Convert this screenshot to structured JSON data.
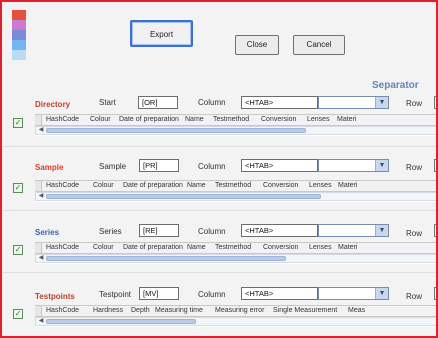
{
  "buttons": {
    "export": "Export",
    "close": "Close",
    "cancel": "Cancel"
  },
  "separator_label": "Separator",
  "colors": {
    "directory": "#c0402a",
    "sample": "#e03a2a",
    "series": "#3b63b6",
    "testpoints": "#c0402a"
  },
  "sections": [
    {
      "title": "Directory",
      "field_label": "Start",
      "field_value": "[OR]",
      "column_label": "Column",
      "column_value": "<HTAB>",
      "row_label": "Row",
      "checked": true,
      "columns": [
        "HashCode",
        "Colour",
        "Date of preparation",
        "Name",
        "Testmethod",
        "Conversion",
        "Lenses",
        "Materi"
      ]
    },
    {
      "title": "Sample",
      "field_label": "Sample",
      "field_value": "[PR]",
      "column_label": "Column",
      "column_value": "<HTAB>",
      "row_label": "Row",
      "checked": true,
      "columns": [
        "HashCode",
        "Colour",
        "Date of preparation",
        "Name",
        "Testmethod",
        "Conversion",
        "Lenses",
        "Materi"
      ]
    },
    {
      "title": "Series",
      "field_label": "Series",
      "field_value": "[RE]",
      "column_label": "Column",
      "column_value": "<HTAB>",
      "row_label": "Row",
      "checked": true,
      "columns": [
        "HashCode",
        "Colour",
        "Date of preparation",
        "Name",
        "Testmethod",
        "Conversion",
        "Lenses",
        "Materi"
      ]
    },
    {
      "title": "Testpoints",
      "field_label": "Testpoint",
      "field_value": "[MV]",
      "column_label": "Column",
      "column_value": "<HTAB>",
      "row_label": "Row",
      "checked": true,
      "columns": [
        "HashCode",
        "Hardness",
        "Depth",
        "Measuring time",
        "Measuring error",
        "Single Measurement",
        "Meas"
      ]
    }
  ],
  "checkmark": "✓",
  "scroll_left_arrow": "◀",
  "dropdown_arrow": "▼"
}
